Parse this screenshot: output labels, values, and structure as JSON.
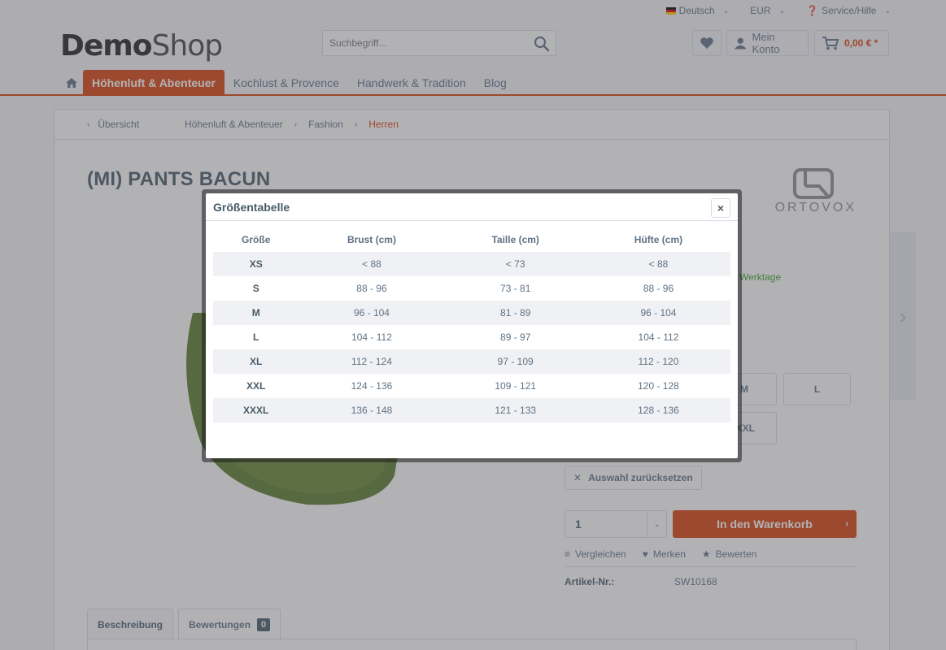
{
  "topnav": {
    "language": "Deutsch",
    "currency": "EUR",
    "service": "Service/Hilfe"
  },
  "logo": {
    "part1": "Demo",
    "part2": "Shop"
  },
  "search": {
    "placeholder": "Suchbegriff..."
  },
  "header": {
    "account_label": "Mein Konto",
    "cart_value": "0,00 € *"
  },
  "mainnav": {
    "items": [
      "Höhenluft & Abenteuer",
      "Kochlust & Provence",
      "Handwerk & Tradition",
      "Blog"
    ]
  },
  "breadcrumb": {
    "back": "Übersicht",
    "items": [
      "Höhenluft & Abenteuer",
      "Fashion",
      "Herren"
    ]
  },
  "product": {
    "title": "(MI) PANTS BACUN",
    "brand": "ORTOVOX",
    "delivery_fragment": "Werktage",
    "sizes_visible": [
      "M",
      "L",
      "XXL"
    ],
    "reset_label": "Auswahl zurücksetzen",
    "quantity": "1",
    "add_to_cart": "In den Warenkorb",
    "compare": "Vergleichen",
    "remember": "Merken",
    "rate": "Bewerten",
    "article_label": "Artikel-Nr.:",
    "article_value": "SW10168"
  },
  "tabs": {
    "description": "Beschreibung",
    "reviews": "Bewertungen",
    "reviews_count": "0"
  },
  "modal": {
    "title": "Größentabelle",
    "close": "×",
    "headers": [
      "Größe",
      "Brust (cm)",
      "Taille (cm)",
      "Hüfte (cm)"
    ],
    "rows": [
      [
        "XS",
        "< 88",
        "< 73",
        "< 88"
      ],
      [
        "S",
        "88 - 96",
        "73 - 81",
        "88 - 96"
      ],
      [
        "M",
        "96 - 104",
        "81 - 89",
        "96 - 104"
      ],
      [
        "L",
        "104 - 112",
        "89 - 97",
        "104 - 112"
      ],
      [
        "XL",
        "112 - 124",
        "97 - 109",
        "112 - 120"
      ],
      [
        "XXL",
        "124 - 136",
        "109 - 121",
        "120 - 128"
      ],
      [
        "XXXL",
        "136 - 148",
        "121 - 133",
        "128 - 136"
      ]
    ]
  },
  "colors": {
    "accent": "#d9400b",
    "text": "#5f7285",
    "success": "#3a9d23"
  }
}
